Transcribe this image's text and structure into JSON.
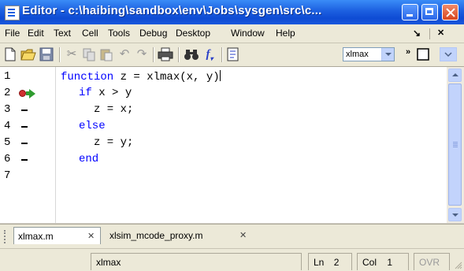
{
  "window": {
    "title": "Editor - c:\\haibing\\sandbox\\env\\Jobs\\sysgen\\src\\c..."
  },
  "menu": [
    "File",
    "Edit",
    "Text",
    "Cell",
    "Tools",
    "Debug",
    "Desktop",
    "Window",
    "Help"
  ],
  "menu_dock": {
    "undock": "↘",
    "close": "✕"
  },
  "toolbar": {
    "function_box": "xlmax",
    "more_label": "»"
  },
  "editor": {
    "lines": [
      {
        "num": "1",
        "code_kw": "function",
        "code_rest": " z = xlmax(x, y)"
      },
      {
        "num": "2",
        "code_kw": "if",
        "code_rest": " x > y",
        "breakpoint": true,
        "current": true
      },
      {
        "num": "3",
        "code_kw": "",
        "code_rest": "z = x;"
      },
      {
        "num": "4",
        "code_kw": "else",
        "code_rest": ""
      },
      {
        "num": "5",
        "code_kw": "",
        "code_rest": "z = y;"
      },
      {
        "num": "6",
        "code_kw": "end",
        "code_rest": ""
      },
      {
        "num": "7",
        "code_kw": "",
        "code_rest": ""
      }
    ]
  },
  "tabs": [
    {
      "label": "xlmax.m",
      "active": true
    },
    {
      "label": "xlsim_mcode_proxy.m",
      "active": false
    }
  ],
  "status": {
    "function": "xlmax",
    "ln_label": "Ln",
    "ln_value": "2",
    "col_label": "Col",
    "col_value": "1",
    "ovr": "OVR"
  },
  "colors": {
    "keyword": "#0000ff",
    "title_bar": "#1c5fe0",
    "breakpoint": "#d03030",
    "current_arrow": "#2f9c2f"
  }
}
